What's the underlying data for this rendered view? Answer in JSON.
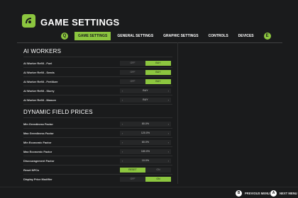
{
  "header": {
    "title": "GAME SETTINGS",
    "logo_icon": "farm-logo-icon"
  },
  "tabs": [
    {
      "label": "GAME SETTINGS",
      "active": true
    },
    {
      "label": "GENERAL SETTINGS",
      "active": false
    },
    {
      "label": "GRAPHIC SETTINGS",
      "active": false
    },
    {
      "label": "CONTROLS",
      "active": false
    },
    {
      "label": "DEVICES",
      "active": false
    }
  ],
  "nav": {
    "prev": "Q",
    "next": "E"
  },
  "ai_workers": {
    "title": "AI WORKERS",
    "rows": [
      {
        "label": "AI Worker Refill - Fuel",
        "type": "toggle",
        "options": [
          "OFF",
          "BUY"
        ],
        "selected": 1
      },
      {
        "label": "AI Worker Refill - Seeds",
        "type": "toggle",
        "options": [
          "OFF",
          "BUY"
        ],
        "selected": 1
      },
      {
        "label": "AI Worker Refill - Fertilizer",
        "type": "toggle",
        "options": [
          "OFF",
          "BUY"
        ],
        "selected": 1
      },
      {
        "label": "AI Worker Refill - Slurry",
        "type": "selector",
        "value": "BUY"
      },
      {
        "label": "AI Worker Refill - Manure",
        "type": "selector",
        "value": "BUY"
      }
    ]
  },
  "dynamic_prices": {
    "title": "DYNAMIC FIELD PRICES",
    "rows": [
      {
        "label": "Min Greediness Factor",
        "type": "selector",
        "value": "80.0%"
      },
      {
        "label": "Max Greediness Factor",
        "type": "selector",
        "value": "120.0%"
      },
      {
        "label": "Min Economic Factor",
        "type": "selector",
        "value": "80.0%"
      },
      {
        "label": "Max Economic Factor",
        "type": "selector",
        "value": "180.0%"
      },
      {
        "label": "Discouragement Factor",
        "type": "selector",
        "value": "10.0%"
      },
      {
        "label": "Reset NPCs",
        "type": "toggle",
        "options": [
          "RESET",
          "ON"
        ],
        "selected": 0
      },
      {
        "label": "Display Price Modifier",
        "type": "toggle",
        "options": [
          "OFF",
          "ON"
        ],
        "selected": 1
      }
    ]
  },
  "footer": {
    "previous": {
      "key": "B",
      "label": "PREVIOUS MENU"
    },
    "next": {
      "key": "A",
      "label": "NEXT MENU"
    }
  },
  "colors": {
    "accent": "#8cc63f",
    "background": "#1a1b1c",
    "row_bg": "#262728"
  }
}
